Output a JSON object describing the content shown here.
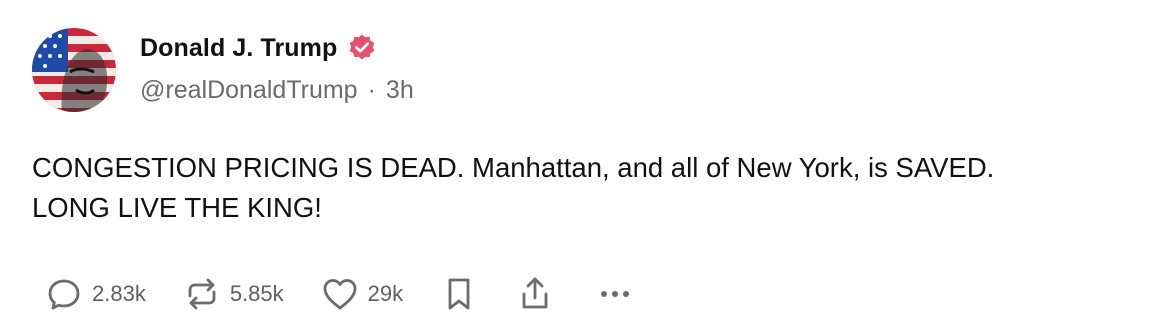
{
  "author": {
    "display_name": "Donald J. Trump",
    "handle": "@realDonaldTrump",
    "separator": "·",
    "timestamp": "3h",
    "verified_color": "#e8506a"
  },
  "post": {
    "line1": "CONGESTION PRICING IS DEAD. Manhattan, and all of New York, is SAVED.",
    "line2": "LONG LIVE THE KING!"
  },
  "actions": {
    "replies": "2.83k",
    "reposts": "5.85k",
    "likes": "29k"
  },
  "icons": {
    "reply": "speech-bubble-icon",
    "repost": "repost-arrows-icon",
    "like": "heart-icon",
    "bookmark": "bookmark-icon",
    "share": "share-upload-icon",
    "more": "more-dots-icon"
  }
}
